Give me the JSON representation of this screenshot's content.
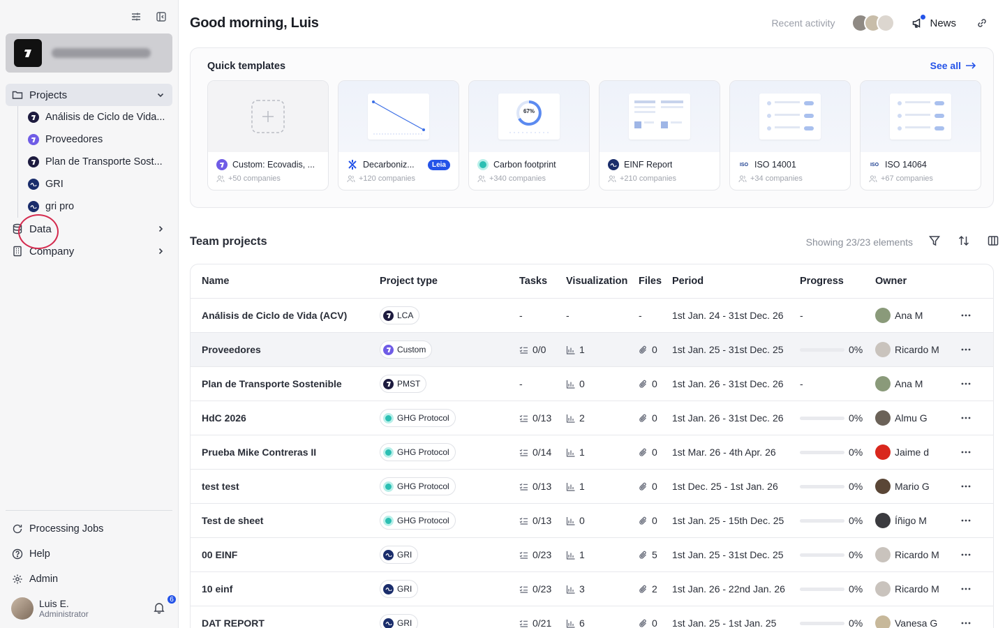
{
  "sidebar": {
    "projects_label": "Projects",
    "projects": [
      {
        "label": "Análisis de Ciclo de Vida...",
        "icon": "dark"
      },
      {
        "label": "Proveedores",
        "icon": "purple"
      },
      {
        "label": "Plan de Transporte Sost...",
        "icon": "dark"
      },
      {
        "label": "GRI",
        "icon": "gri"
      },
      {
        "label": "gri pro",
        "icon": "gri"
      }
    ],
    "data_label": "Data",
    "company_label": "Company",
    "processing_jobs_label": "Processing Jobs",
    "help_label": "Help",
    "admin_label": "Admin",
    "user_name": "Luis E.",
    "user_role": "Administrator",
    "notification_count": "6"
  },
  "header": {
    "greeting": "Good morning, Luis",
    "recent_activity": "Recent activity",
    "news_label": "News"
  },
  "templates": {
    "title": "Quick templates",
    "see_all": "See all",
    "cards": [
      {
        "name": "Custom: Ecovadis, ...",
        "count": "+50 companies",
        "icon": "purple",
        "tag": ""
      },
      {
        "name": "Decarboniz...",
        "count": "+120 companies",
        "icon": "x-blue",
        "tag": "Leia"
      },
      {
        "name": "Carbon footprint",
        "count": "+340 companies",
        "icon": "teal",
        "tag": "",
        "thumb_value": "67%"
      },
      {
        "name": "EINF Report",
        "count": "+210 companies",
        "icon": "gri",
        "tag": ""
      },
      {
        "name": "ISO 14001",
        "count": "+34 companies",
        "icon": "iso",
        "tag": ""
      },
      {
        "name": "ISO 14064",
        "count": "+67 companies",
        "icon": "iso",
        "tag": ""
      }
    ]
  },
  "team_projects": {
    "title": "Team projects",
    "showing": "Showing 23/23 elements",
    "columns": {
      "name": "Name",
      "type": "Project type",
      "tasks": "Tasks",
      "visualization": "Visualization",
      "files": "Files",
      "period": "Period",
      "progress": "Progress",
      "owner": "Owner"
    },
    "rows": [
      {
        "name": "Análisis de Ciclo de Vida (ACV)",
        "type": "LCA",
        "type_icon": "dark",
        "tasks": "-",
        "vis": "-",
        "files": "-",
        "period": "1st Jan. 24 - 31st Dec. 26",
        "progress": "-",
        "progress_value": null,
        "owner": "Ana M",
        "owner_color": "#8a9a7a"
      },
      {
        "name": "Proveedores",
        "type": "Custom",
        "type_icon": "purple",
        "tasks": "0/0",
        "vis": "1",
        "files": "0",
        "period": "1st Jan. 25 - 31st Dec. 25",
        "progress": "0%",
        "progress_value": 0,
        "owner": "Ricardo M",
        "owner_color": "#c9c3bd"
      },
      {
        "name": "Plan de Transporte Sostenible",
        "type": "PMST",
        "type_icon": "dark",
        "tasks": "-",
        "vis": "0",
        "files": "0",
        "period": "1st Jan. 26 - 31st Dec. 26",
        "progress": "-",
        "progress_value": null,
        "owner": "Ana M",
        "owner_color": "#8a9a7a"
      },
      {
        "name": "HdC 2026",
        "type": "GHG Protocol",
        "type_icon": "teal",
        "tasks": "0/13",
        "vis": "2",
        "files": "0",
        "period": "1st Jan. 26 - 31st Dec. 26",
        "progress": "0%",
        "progress_value": 0,
        "owner": "Almu G",
        "owner_color": "#6b6258"
      },
      {
        "name": "Prueba Mike Contreras II",
        "type": "GHG Protocol",
        "type_icon": "teal",
        "tasks": "0/14",
        "vis": "1",
        "files": "0",
        "period": "1st Mar. 26 - 4th Apr. 26",
        "progress": "0%",
        "progress_value": 0,
        "owner": "Jaime d",
        "owner_color": "#d9271d"
      },
      {
        "name": "test test",
        "type": "GHG Protocol",
        "type_icon": "teal",
        "tasks": "0/13",
        "vis": "1",
        "files": "0",
        "period": "1st Dec. 25 - 1st Jan. 26",
        "progress": "0%",
        "progress_value": 0,
        "owner": "Mario G",
        "owner_color": "#5a4636"
      },
      {
        "name": "Test de sheet",
        "type": "GHG Protocol",
        "type_icon": "teal",
        "tasks": "0/13",
        "vis": "0",
        "files": "0",
        "period": "1st Jan. 25 - 15th Dec. 25",
        "progress": "0%",
        "progress_value": 0,
        "owner": "Íñigo M",
        "owner_color": "#3b3b3f"
      },
      {
        "name": "00 EINF",
        "type": "GRI",
        "type_icon": "gri",
        "tasks": "0/23",
        "vis": "1",
        "files": "5",
        "period": "1st Jan. 25 - 31st Dec. 25",
        "progress": "0%",
        "progress_value": 0,
        "owner": "Ricardo M",
        "owner_color": "#c9c3bd"
      },
      {
        "name": "10 einf",
        "type": "GRI",
        "type_icon": "gri",
        "tasks": "0/23",
        "vis": "3",
        "files": "2",
        "period": "1st Jan. 26 - 22nd Jan. 26",
        "progress": "0%",
        "progress_value": 0,
        "owner": "Ricardo M",
        "owner_color": "#c9c3bd"
      },
      {
        "name": "DAT REPORT",
        "type": "GRI",
        "type_icon": "gri",
        "tasks": "0/21",
        "vis": "6",
        "files": "0",
        "period": "1st Jan. 25 - 1st Jan. 25",
        "progress": "0%",
        "progress_value": 0,
        "owner": "Vanesa G",
        "owner_color": "#c7b89a"
      }
    ]
  }
}
